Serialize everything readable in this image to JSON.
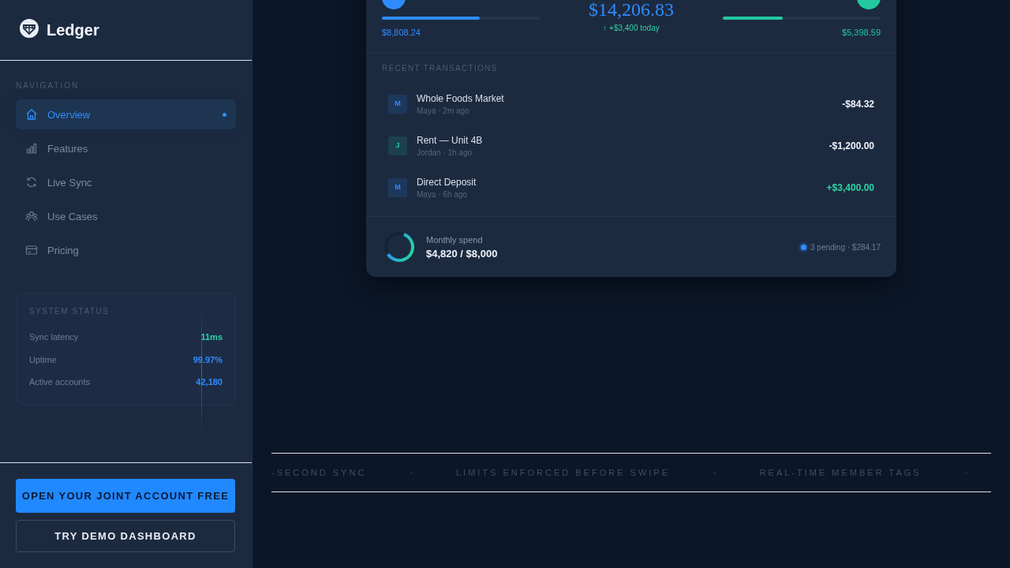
{
  "brand": {
    "name": "Ledger"
  },
  "sidebar": {
    "heading": "NAVIGATION",
    "items": [
      {
        "label": "Overview",
        "selected": true
      },
      {
        "label": "Features",
        "selected": false
      },
      {
        "label": "Live Sync",
        "selected": false
      },
      {
        "label": "Use Cases",
        "selected": false
      },
      {
        "label": "Pricing",
        "selected": false
      }
    ]
  },
  "system_status": {
    "title": "SYSTEM STATUS",
    "rows": [
      {
        "label": "Sync latency",
        "value": "11ms",
        "color": "#2dd4a4"
      },
      {
        "label": "Uptime",
        "value": "99.97%",
        "color": "#2f8cff"
      },
      {
        "label": "Active accounts",
        "value": "42,180",
        "color": "#2f8cff"
      }
    ]
  },
  "buttons": [
    {
      "label": "OPEN YOUR JOINT ACCOUNT FREE",
      "kind": "primary"
    },
    {
      "label": "TRY DEMO DASHBOARD",
      "kind": "outline"
    }
  ],
  "account_card": {
    "members": [
      {
        "amount": "$8,808.24",
        "level": 0.62,
        "color": "#2f8cff"
      },
      {
        "amount": "$5,398.59",
        "level": 0.38,
        "color": "#22c9a0"
      }
    ],
    "balance": "$14,206.83",
    "change": "↑ +$3,400 today",
    "transactions_heading": "RECENT TRANSACTIONS",
    "transactions": [
      {
        "initial": "M",
        "color": "#2f8cff",
        "title": "Whole Foods Market",
        "meta": "Maya · 2m ago",
        "amount": "-$84.32",
        "kind": "debit"
      },
      {
        "initial": "J",
        "color": "#22c9a0",
        "title": "Rent — Unit 4B",
        "meta": "Jordan · 1h ago",
        "amount": "-$1,200.00",
        "kind": "debit"
      },
      {
        "initial": "M",
        "color": "#2f8cff",
        "title": "Direct Deposit",
        "meta": "Maya · 6h ago",
        "amount": "+$3,400.00",
        "kind": "credit"
      }
    ],
    "spend": {
      "label": "Monthly spend",
      "value": "$4,820 / $8,000",
      "level": 0.6
    },
    "pending": "3 pending · $284.17"
  },
  "ticker": [
    "-SECOND SYNC",
    "LIMITS ENFORCED BEFORE SWIPE",
    "REAL-TIME MEMBER TAGS"
  ]
}
